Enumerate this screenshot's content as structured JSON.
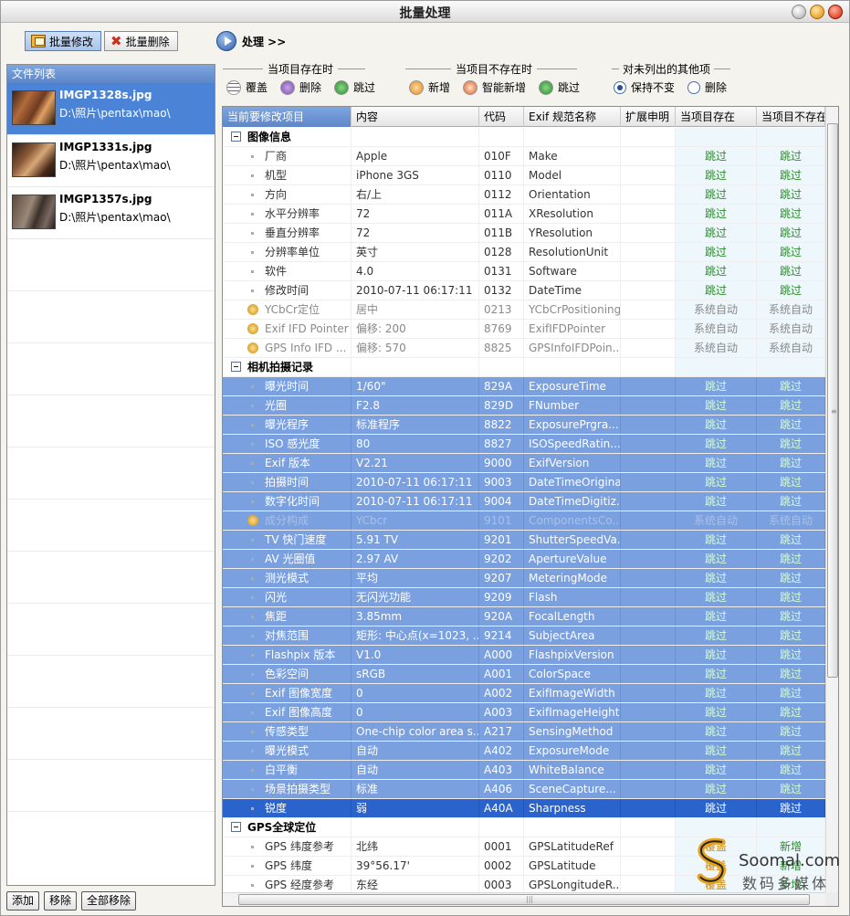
{
  "window": {
    "title": "批量处理"
  },
  "toolbar": {
    "batch_edit": "批量修改",
    "batch_delete": "批量删除",
    "process": "处理 >>"
  },
  "filelist": {
    "header": "文件列表",
    "items": [
      {
        "name": "IMGP1328s.jpg",
        "path": "D:\\照片\\pentax\\mao\\"
      },
      {
        "name": "IMGP1331s.jpg",
        "path": "D:\\照片\\pentax\\mao\\"
      },
      {
        "name": "IMGP1357s.jpg",
        "path": "D:\\照片\\pentax\\mao\\"
      }
    ],
    "buttons": {
      "add": "添加",
      "remove": "移除",
      "remove_all": "全部移除"
    }
  },
  "options": {
    "exists": {
      "title": "当项目存在时",
      "opts": [
        "覆盖",
        "删除",
        "跳过"
      ]
    },
    "not_exists": {
      "title": "当项目不存在时",
      "opts": [
        "新增",
        "智能新增",
        "跳过"
      ]
    },
    "others": {
      "title": "对未列出的其他项",
      "opts": [
        "保持不变",
        "删除"
      ],
      "selected": "保持不变"
    }
  },
  "table": {
    "columns": [
      "当前要修改项目",
      "内容",
      "代码",
      "Exif 规范名称",
      "扩展申明",
      "当项目存在",
      "当项目不存在"
    ],
    "groups": [
      {
        "title": "图像信息",
        "rows": [
          {
            "name": "厂商",
            "value": "Apple",
            "code": "010F",
            "exif": "Make",
            "exist": "跳过",
            "notexist": "跳过"
          },
          {
            "name": "机型",
            "value": "iPhone 3GS",
            "code": "0110",
            "exif": "Model",
            "exist": "跳过",
            "notexist": "跳过"
          },
          {
            "name": "方向",
            "value": "右/上",
            "code": "0112",
            "exif": "Orientation",
            "exist": "跳过",
            "notexist": "跳过"
          },
          {
            "name": "水平分辨率",
            "value": "72",
            "code": "011A",
            "exif": "XResolution",
            "exist": "跳过",
            "notexist": "跳过"
          },
          {
            "name": "垂直分辨率",
            "value": "72",
            "code": "011B",
            "exif": "YResolution",
            "exist": "跳过",
            "notexist": "跳过"
          },
          {
            "name": "分辨率单位",
            "value": "英寸",
            "code": "0128",
            "exif": "ResolutionUnit",
            "exist": "跳过",
            "notexist": "跳过"
          },
          {
            "name": "软件",
            "value": "4.0",
            "code": "0131",
            "exif": "Software",
            "exist": "跳过",
            "notexist": "跳过"
          },
          {
            "name": "修改时间",
            "value": "2010-07-11 06:17:11",
            "code": "0132",
            "exif": "DateTime",
            "exist": "跳过",
            "notexist": "跳过"
          },
          {
            "name": "YCbCr定位",
            "value": "居中",
            "code": "0213",
            "exif": "YCbCrPositioning",
            "exist": "系统自动",
            "notexist": "系统自动",
            "sys": true
          },
          {
            "name": "Exif IFD Pointer",
            "value": "偏移: 200",
            "code": "8769",
            "exif": "ExifIFDPointer",
            "exist": "系统自动",
            "notexist": "系统自动",
            "sys": true
          },
          {
            "name": "GPS Info IFD ...",
            "value": "偏移: 570",
            "code": "8825",
            "exif": "GPSInfoIFDPoin...",
            "exist": "系统自动",
            "notexist": "系统自动",
            "sys": true
          }
        ]
      },
      {
        "title": "相机拍摄记录",
        "rows": [
          {
            "name": "曝光时间",
            "value": "1/60\"",
            "code": "829A",
            "exif": "ExposureTime",
            "exist": "跳过",
            "notexist": "跳过",
            "sel": true
          },
          {
            "name": "光圈",
            "value": "F2.8",
            "code": "829D",
            "exif": "FNumber",
            "exist": "跳过",
            "notexist": "跳过",
            "sel": true
          },
          {
            "name": "曝光程序",
            "value": "标准程序",
            "code": "8822",
            "exif": "ExposurePrgra...",
            "exist": "跳过",
            "notexist": "跳过",
            "sel": true
          },
          {
            "name": "ISO 感光度",
            "value": "80",
            "code": "8827",
            "exif": "ISOSpeedRatin...",
            "exist": "跳过",
            "notexist": "跳过",
            "sel": true
          },
          {
            "name": "Exif 版本",
            "value": "V2.21",
            "code": "9000",
            "exif": "ExifVersion",
            "exist": "跳过",
            "notexist": "跳过",
            "sel": true
          },
          {
            "name": "拍摄时间",
            "value": "2010-07-11 06:17:11",
            "code": "9003",
            "exif": "DateTimeOriginal",
            "exist": "跳过",
            "notexist": "跳过",
            "sel": true
          },
          {
            "name": "数字化时间",
            "value": "2010-07-11 06:17:11",
            "code": "9004",
            "exif": "DateTimeDigitiz...",
            "exist": "跳过",
            "notexist": "跳过",
            "sel": true
          },
          {
            "name": "成分构成",
            "value": "YCbcr",
            "code": "9101",
            "exif": "ComponentsCo...",
            "exist": "系统自动",
            "notexist": "系统自动",
            "sel": true,
            "sys": true
          },
          {
            "name": "TV 快门速度",
            "value": "5.91 TV",
            "code": "9201",
            "exif": "ShutterSpeedVa...",
            "exist": "跳过",
            "notexist": "跳过",
            "sel": true
          },
          {
            "name": "AV 光圈值",
            "value": "2.97 AV",
            "code": "9202",
            "exif": "ApertureValue",
            "exist": "跳过",
            "notexist": "跳过",
            "sel": true
          },
          {
            "name": "测光模式",
            "value": "平均",
            "code": "9207",
            "exif": "MeteringMode",
            "exist": "跳过",
            "notexist": "跳过",
            "sel": true
          },
          {
            "name": "闪光",
            "value": "无闪光功能",
            "code": "9209",
            "exif": "Flash",
            "exist": "跳过",
            "notexist": "跳过",
            "sel": true
          },
          {
            "name": "焦距",
            "value": "3.85mm",
            "code": "920A",
            "exif": "FocalLength",
            "exist": "跳过",
            "notexist": "跳过",
            "sel": true
          },
          {
            "name": "对焦范围",
            "value": "矩形: 中心点(x=1023, ...",
            "code": "9214",
            "exif": "SubjectArea",
            "exist": "跳过",
            "notexist": "跳过",
            "sel": true
          },
          {
            "name": "Flashpix 版本",
            "value": "V1.0",
            "code": "A000",
            "exif": "FlashpixVersion",
            "exist": "跳过",
            "notexist": "跳过",
            "sel": true
          },
          {
            "name": "色彩空间",
            "value": "sRGB",
            "code": "A001",
            "exif": "ColorSpace",
            "exist": "跳过",
            "notexist": "跳过",
            "sel": true
          },
          {
            "name": "Exif 图像宽度",
            "value": "0",
            "code": "A002",
            "exif": "ExifImageWidth",
            "exist": "跳过",
            "notexist": "跳过",
            "sel": true
          },
          {
            "name": "Exif 图像高度",
            "value": "0",
            "code": "A003",
            "exif": "ExifImageHeight",
            "exist": "跳过",
            "notexist": "跳过",
            "sel": true
          },
          {
            "name": "传感类型",
            "value": "One-chip color area s...",
            "code": "A217",
            "exif": "SensingMethod",
            "exist": "跳过",
            "notexist": "跳过",
            "sel": true
          },
          {
            "name": "曝光模式",
            "value": "自动",
            "code": "A402",
            "exif": "ExposureMode",
            "exist": "跳过",
            "notexist": "跳过",
            "sel": true
          },
          {
            "name": "白平衡",
            "value": "自动",
            "code": "A403",
            "exif": "WhiteBalance",
            "exist": "跳过",
            "notexist": "跳过",
            "sel": true
          },
          {
            "name": "场景拍摄类型",
            "value": "标准",
            "code": "A406",
            "exif": "SceneCapture...",
            "exist": "跳过",
            "notexist": "跳过",
            "sel": true
          },
          {
            "name": "锐度",
            "value": "弱",
            "code": "A40A",
            "exif": "Sharpness",
            "exist": "跳过",
            "notexist": "跳过",
            "hot": true
          }
        ]
      },
      {
        "title": "GPS全球定位",
        "rows": [
          {
            "name": "GPS 纬度参考",
            "value": "北纬",
            "code": "0001",
            "exif": "GPSLatitudeRef",
            "exist": "覆盖",
            "notexist": "新增",
            "gps": true
          },
          {
            "name": "GPS 纬度",
            "value": "39°56.17'",
            "code": "0002",
            "exif": "GPSLatitude",
            "exist": "覆盖",
            "notexist": "新增",
            "gps": true
          },
          {
            "name": "GPS 经度参考",
            "value": "东经",
            "code": "0003",
            "exif": "GPSLongitudeR...",
            "exist": "覆盖",
            "notexist": "新增",
            "gps": true
          }
        ]
      }
    ]
  },
  "watermark": {
    "brand": "Soomal.com",
    "sub": "数码多媒体"
  }
}
